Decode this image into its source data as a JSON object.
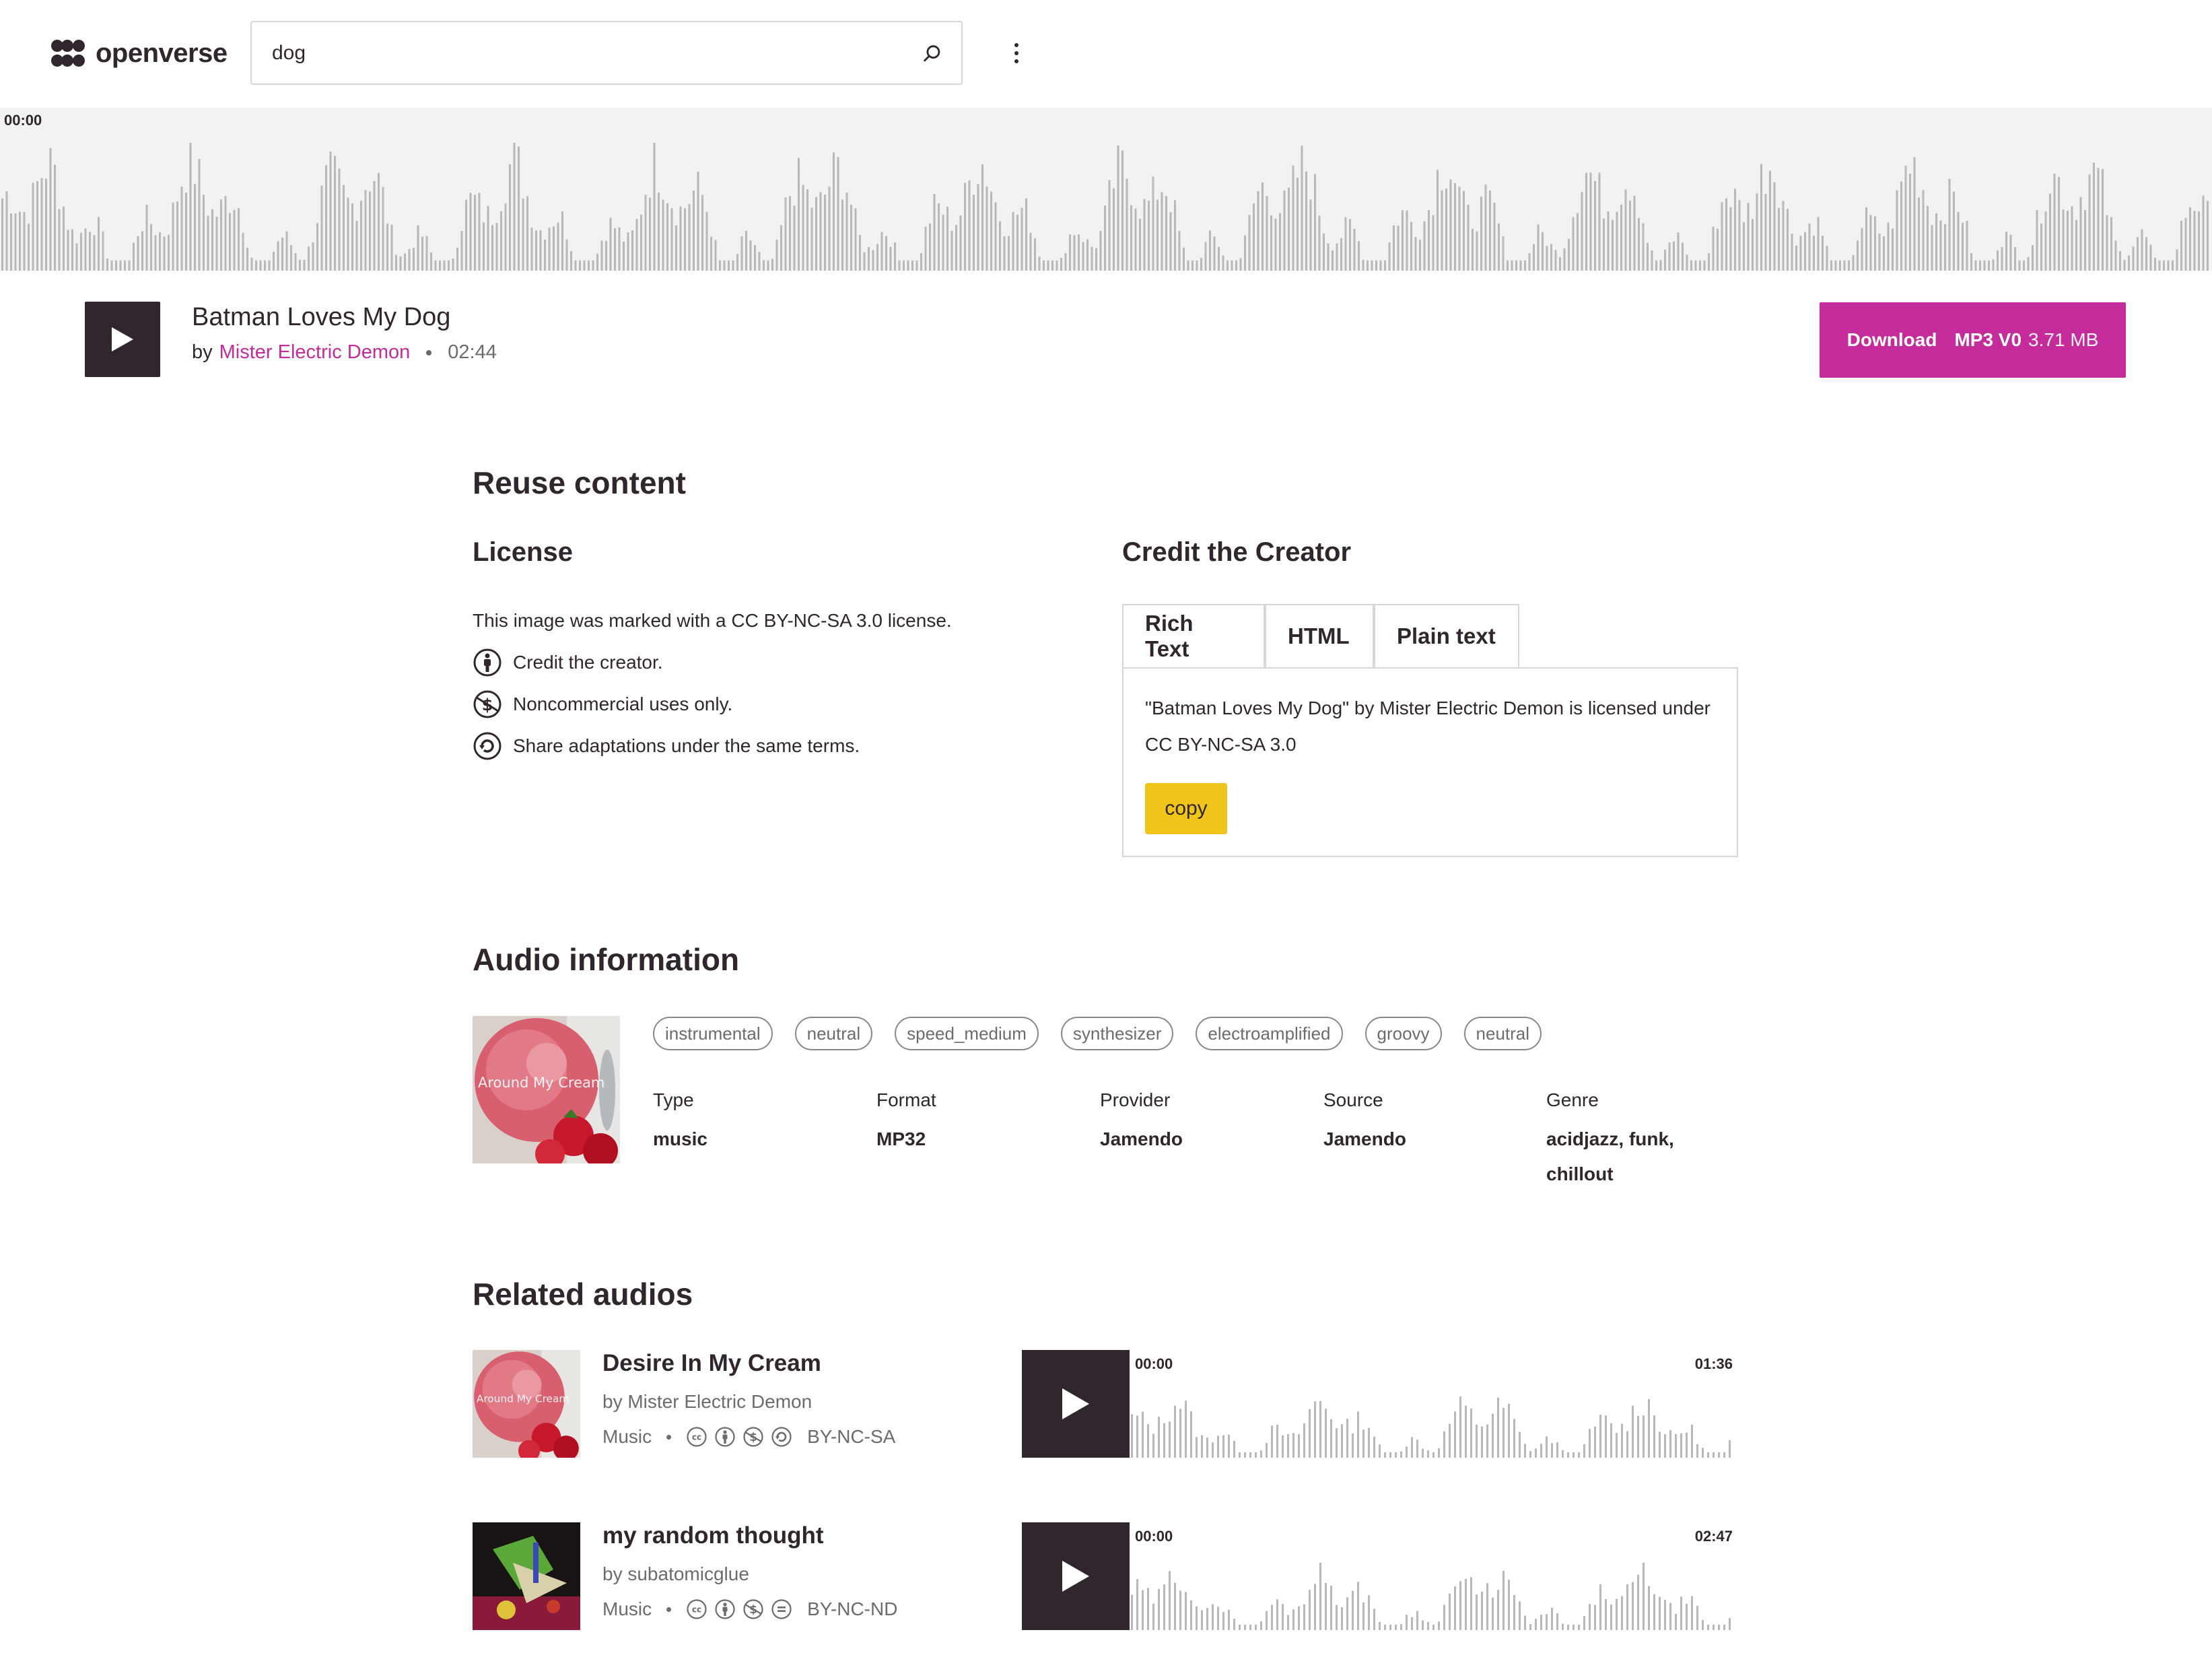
{
  "header": {
    "logo_text": "openverse",
    "search_value": "dog",
    "search_icon": "search-icon",
    "menu_icon": "more-vertical-icon"
  },
  "player": {
    "current_time": "00:00",
    "title": "Batman Loves My Dog",
    "by_prefix": "by",
    "creator": "Mister Electric Demon",
    "duration": "02:44",
    "download_label": "Download",
    "download_format": "MP3 V0",
    "download_size": "3.71 MB",
    "accent_color": "#c52b9b"
  },
  "reuse": {
    "heading": "Reuse content",
    "license_heading": "License",
    "license_statement": "This image was marked with a CC BY-NC-SA 3.0 license.",
    "license_items": [
      {
        "icon": "cc-by-icon",
        "text": "Credit the creator."
      },
      {
        "icon": "cc-nc-icon",
        "text": "Noncommercial uses only."
      },
      {
        "icon": "cc-sa-icon",
        "text": "Share adaptations under the same terms."
      }
    ],
    "credit_heading": "Credit the Creator",
    "tabs": [
      "Rich Text",
      "HTML",
      "Plain text"
    ],
    "active_tab": "Rich Text",
    "credit_text": "\"Batman Loves My Dog\" by Mister Electric Demon is licensed under CC BY-NC-SA 3.0",
    "copy_label": "copy"
  },
  "audio_info": {
    "heading": "Audio information",
    "thumbnail_caption": "Around My Cream",
    "tags": [
      "instrumental",
      "neutral",
      "speed_medium",
      "synthesizer",
      "electroamplified",
      "groovy",
      "neutral"
    ],
    "fields": [
      {
        "label": "Type",
        "value": "music"
      },
      {
        "label": "Format",
        "value": "MP32"
      },
      {
        "label": "Provider",
        "value": "Jamendo"
      },
      {
        "label": "Source",
        "value": "Jamendo"
      },
      {
        "label": "Genre",
        "value": "acidjazz, funk, chillout"
      }
    ]
  },
  "related": {
    "heading": "Related audios",
    "items": [
      {
        "title": "Desire In My Cream",
        "by": "by Mister Electric Demon",
        "category": "Music",
        "license": "BY-NC-SA",
        "license_icons": [
          "cc-icon",
          "cc-by-icon",
          "cc-nc-icon",
          "cc-sa-icon"
        ],
        "start": "00:00",
        "duration": "01:36",
        "thumbnail_caption": "Around My Cream"
      },
      {
        "title": "my random thought",
        "by": "by subatomicglue",
        "category": "Music",
        "license": "BY-NC-ND",
        "license_icons": [
          "cc-icon",
          "cc-by-icon",
          "cc-nc-icon",
          "cc-nd-icon"
        ],
        "start": "00:00",
        "duration": "02:47",
        "thumbnail_caption": ""
      }
    ]
  }
}
